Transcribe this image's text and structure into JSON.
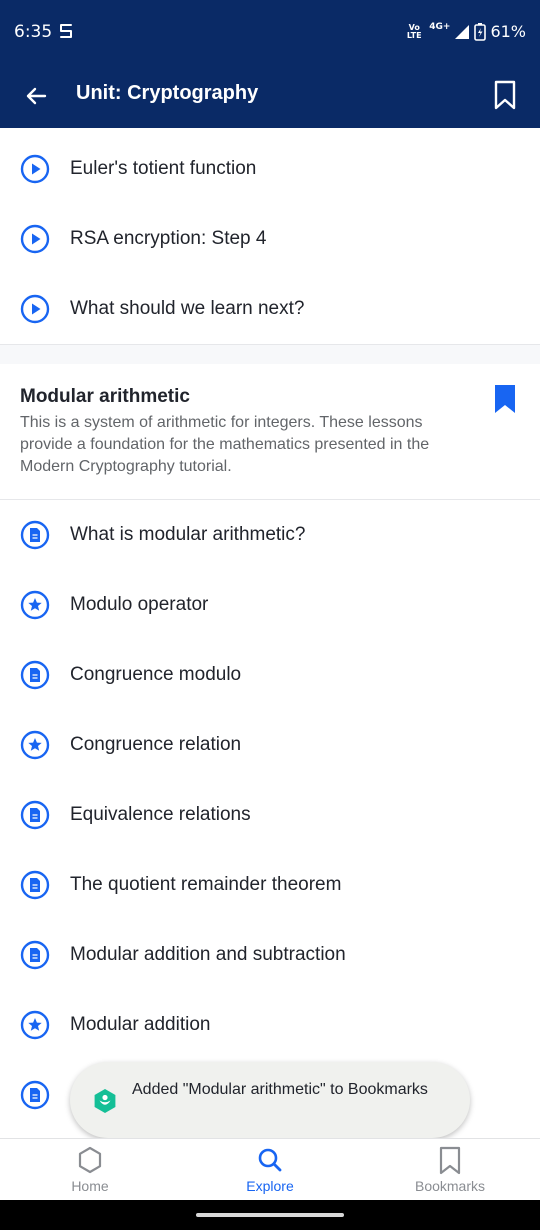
{
  "status_bar": {
    "time": "6:35",
    "volte": "Vo LTE",
    "network": "4G+",
    "battery": "61%"
  },
  "app_bar": {
    "title": "Unit: Cryptography",
    "back_icon": "arrow-left-icon",
    "bookmark_icon": "bookmark-outline-icon"
  },
  "previous_items": [
    {
      "label": "Euler's totient function",
      "type": "video"
    },
    {
      "label": "RSA encryption: Step 4",
      "type": "video"
    },
    {
      "label": "What should we learn next?",
      "type": "video"
    }
  ],
  "section": {
    "title": "Modular arithmetic",
    "description": "This is a system of arithmetic for integers. These lessons provide a foundation for the mathematics presented in the Modern Cryptography tutorial.",
    "bookmarked": true
  },
  "section_items": [
    {
      "label": "What is modular arithmetic?",
      "type": "article"
    },
    {
      "label": "Modulo operator",
      "type": "exercise"
    },
    {
      "label": "Congruence modulo",
      "type": "article"
    },
    {
      "label": "Congruence relation",
      "type": "exercise"
    },
    {
      "label": "Equivalence relations",
      "type": "article"
    },
    {
      "label": "The quotient remainder theorem",
      "type": "article"
    },
    {
      "label": "Modular addition and subtraction",
      "type": "article"
    },
    {
      "label": "Modular addition",
      "type": "exercise"
    },
    {
      "label": "",
      "type": "article"
    }
  ],
  "toast": {
    "message": "Added \"Modular arithmetic\" to Bookmarks"
  },
  "bottom_nav": [
    {
      "label": "Home",
      "icon": "hexagon-icon",
      "active": false
    },
    {
      "label": "Explore",
      "icon": "search-icon",
      "active": true
    },
    {
      "label": "Bookmarks",
      "icon": "bookmark-outline-icon",
      "active": false
    }
  ],
  "colors": {
    "header_bg": "#0a2a66",
    "accent": "#1865f2",
    "text_primary": "#21242c",
    "text_secondary": "#626569",
    "toast_bg": "#f0f1ee",
    "toast_logo": "#14bf96"
  }
}
